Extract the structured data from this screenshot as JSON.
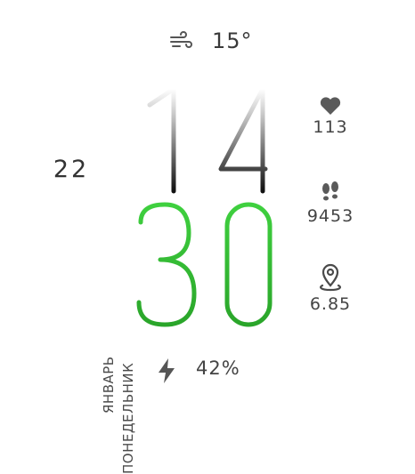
{
  "weather": {
    "icon": "wind-icon",
    "temperature": "15°"
  },
  "time": {
    "hours": "14",
    "minutes": "30"
  },
  "date": {
    "day": "22",
    "month": "ЯНВАРЬ",
    "weekday": "ПОНЕДЕЛЬНИК"
  },
  "stats": {
    "heart_rate": {
      "icon": "heart-icon",
      "value": "113"
    },
    "steps": {
      "icon": "footsteps-icon",
      "value": "9453"
    },
    "distance": {
      "icon": "location-pin-icon",
      "value": "6.85"
    }
  },
  "battery": {
    "icon": "lightning-icon",
    "value": "42%"
  },
  "colors": {
    "minutes": "#3cc43c",
    "hours": "#3a3a3a",
    "text": "#444444"
  }
}
